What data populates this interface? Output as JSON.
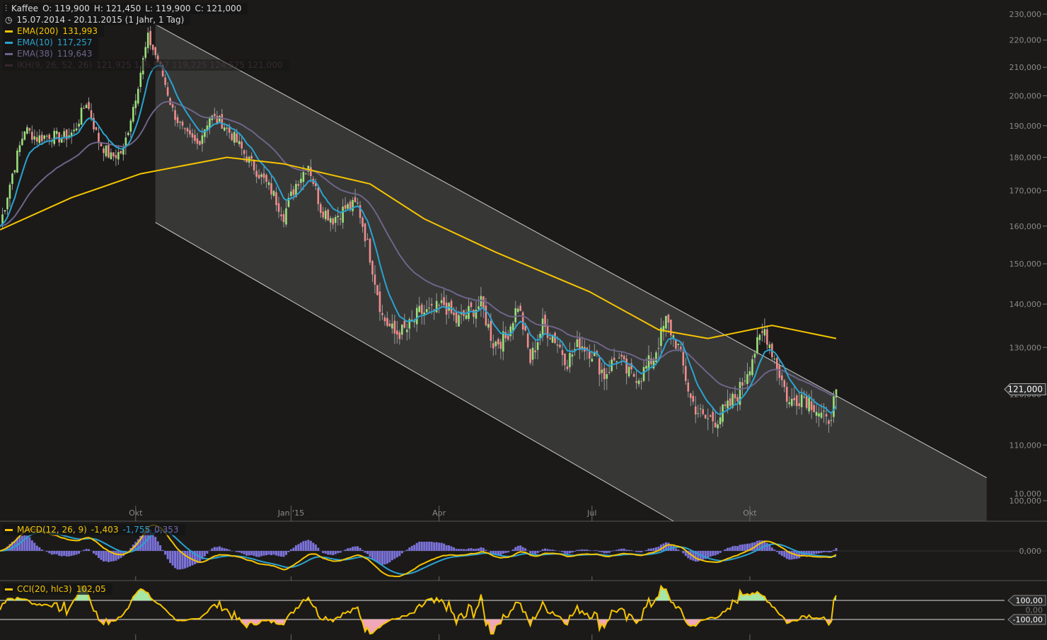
{
  "header": {
    "symbol": "Kaffee",
    "open": "O: 119,900",
    "high": "H: 121,450",
    "low": "L: 119,900",
    "close": "C: 121,000",
    "range": "15.07.2014 - 20.11.2015 (1 Jahr, 1 Tag)"
  },
  "legend": [
    {
      "label": "EMA(200)",
      "value": "131,993",
      "color": "#f5c400"
    },
    {
      "label": "EMA(10)",
      "value": "117,257",
      "color": "#2aa3d0"
    },
    {
      "label": "EMA(38)",
      "value": "119,643",
      "color": "#6e6488"
    },
    {
      "label": "IKH(9, 26, 52, 26)",
      "value": "121,925  116,527  119,225  124,575  121,000",
      "color": "#4a3040"
    }
  ],
  "macd": {
    "label": "MACD(12, 26, 9)",
    "v1": "-1,403",
    "v2": "-1,755",
    "v3": "0,353",
    "ticks": [
      "10,000",
      "0,000"
    ]
  },
  "cci": {
    "label": "CCI(20, hlc3)",
    "value": "102,05",
    "ticks": [
      "100,00",
      "0,00",
      "-100,00"
    ]
  },
  "last_price": "121,000",
  "chart_data": {
    "type": "candlestick",
    "title": "Kaffee",
    "y_scale": "log",
    "ylim": [
      100000,
      230000
    ],
    "yticks": [
      "230,000",
      "220,000",
      "210,000",
      "200,000",
      "190,000",
      "180,000",
      "170,000",
      "160,000",
      "150,000",
      "140,000",
      "130,000",
      "120,000",
      "110,000",
      "100,000"
    ],
    "ytick_values": [
      230,
      220,
      210,
      200,
      190,
      180,
      170,
      160,
      150,
      140,
      130,
      120,
      110,
      100
    ],
    "xticks": [
      {
        "label": "Okt",
        "day": 55
      },
      {
        "label": "Jan '15",
        "day": 118
      },
      {
        "label": "Apr",
        "day": 178
      },
      {
        "label": "Jul",
        "day": 240
      },
      {
        "label": "Okt",
        "day": 304
      }
    ],
    "total_days": 340,
    "weekly_close": [
      160,
      175,
      189,
      186,
      187,
      186,
      188,
      198,
      185,
      180,
      182,
      200,
      221,
      210,
      195,
      187,
      184,
      193,
      191,
      186,
      180,
      175,
      170,
      163,
      172,
      178,
      165,
      162,
      165,
      166,
      152,
      137,
      133,
      134,
      138,
      138,
      140,
      136,
      138,
      140,
      131,
      132,
      140,
      127,
      135,
      132,
      127,
      131,
      129,
      124,
      128,
      124,
      124,
      128,
      136,
      130,
      119,
      115,
      115,
      117,
      121,
      128,
      134,
      126,
      118,
      120,
      118,
      114,
      121
    ],
    "ema200": [
      [
        0,
        159
      ],
      [
        29,
        168
      ],
      [
        57,
        175
      ],
      [
        92,
        180
      ],
      [
        115,
        178
      ],
      [
        150,
        172
      ],
      [
        172,
        162
      ],
      [
        201,
        153
      ],
      [
        239,
        143
      ],
      [
        267,
        134
      ],
      [
        287,
        132
      ],
      [
        313,
        135
      ],
      [
        339,
        132
      ]
    ],
    "channel": {
      "upper": [
        [
          63,
          226
        ],
        [
          400,
          104
        ]
      ],
      "lower": [
        [
          63,
          161
        ],
        [
          273,
          100
        ]
      ]
    }
  }
}
